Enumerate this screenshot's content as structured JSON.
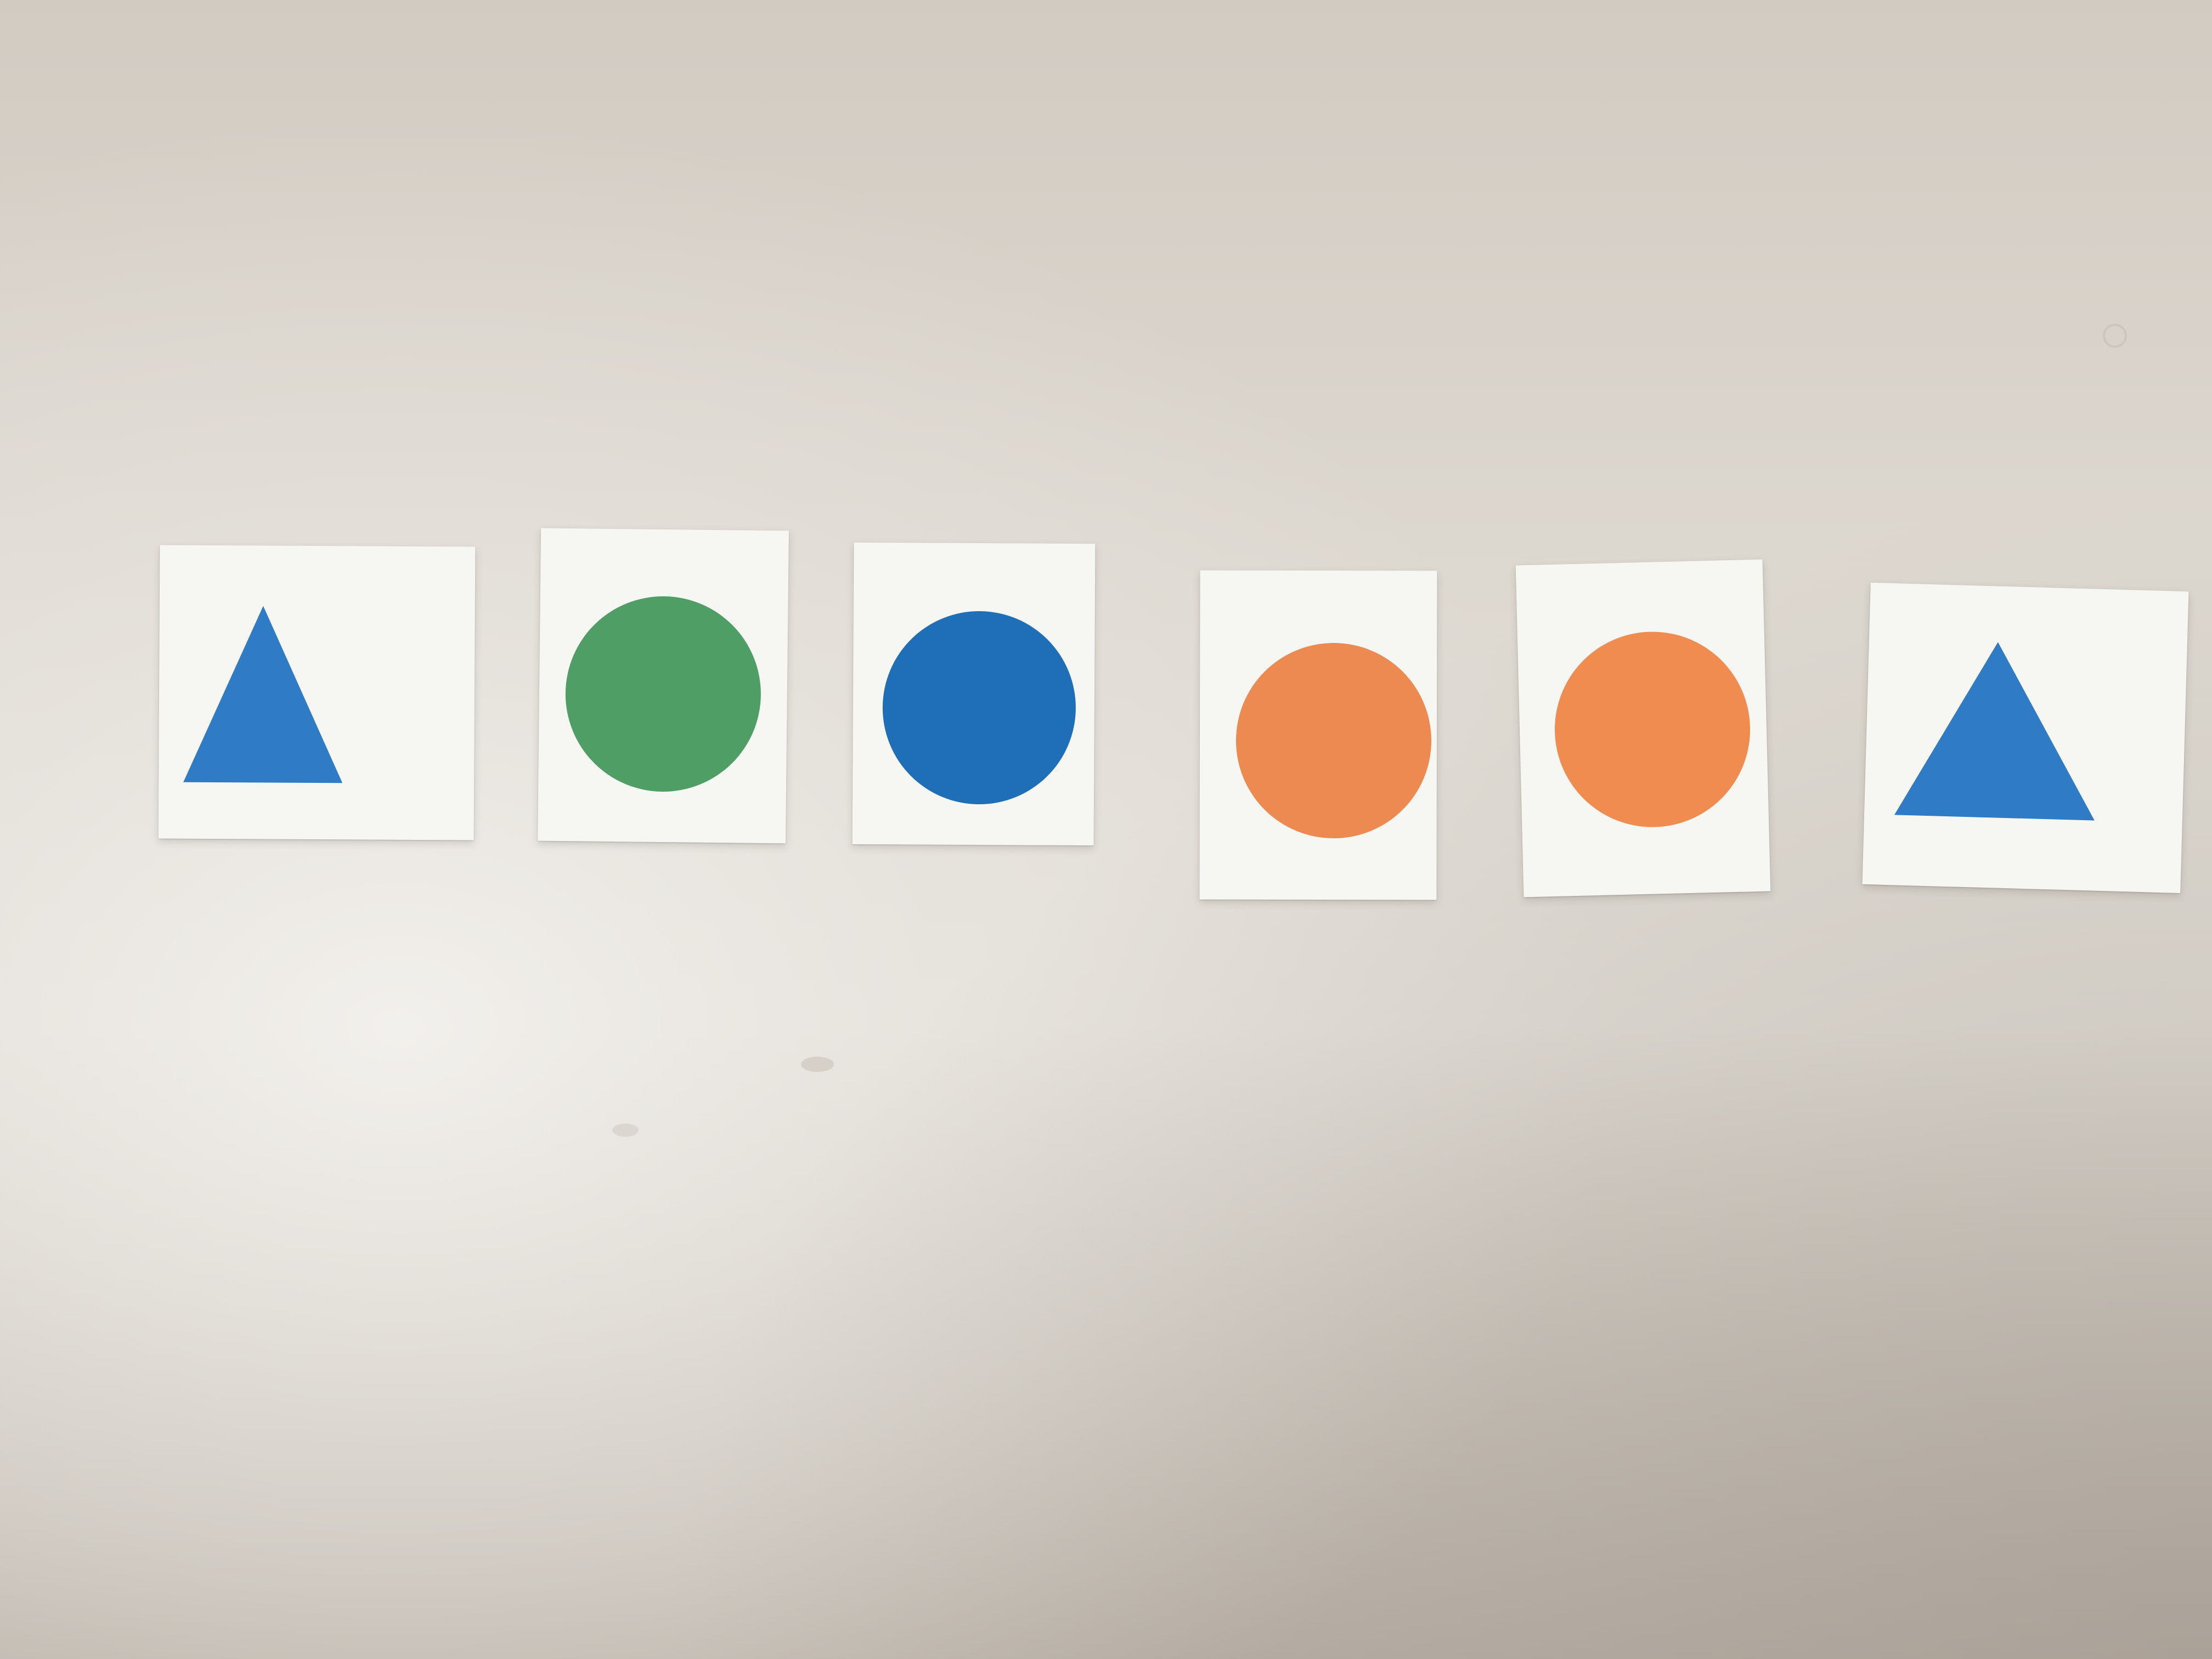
{
  "scene": {
    "surface_color": "#dcd6cd",
    "card_color": "#f6f6f3"
  },
  "cards": [
    {
      "shape": "triangle",
      "color": "#2f7bc6"
    },
    {
      "shape": "circle",
      "color": "#4e9e66"
    },
    {
      "shape": "circle",
      "color": "#1f6fb8"
    },
    {
      "shape": "circle",
      "color": "#ec8a52"
    },
    {
      "shape": "circle",
      "color": "#f08c50"
    },
    {
      "shape": "triangle",
      "color": "#2f7bc6"
    }
  ]
}
